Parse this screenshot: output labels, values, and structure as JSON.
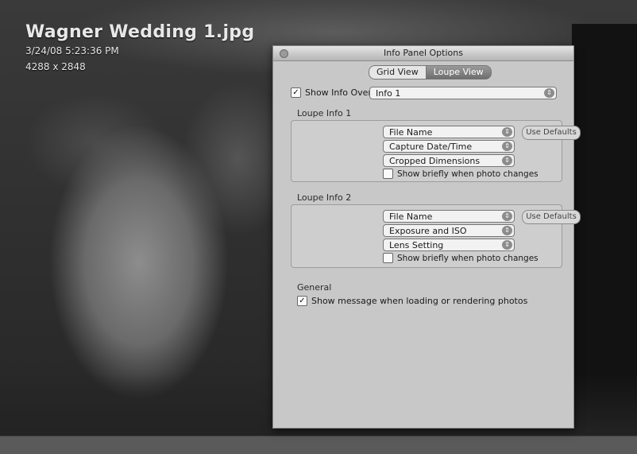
{
  "photo": {
    "filename": "Wagner Wedding 1.jpg",
    "date": "3/24/08 5:23:36 PM",
    "dimensions": "4288 x 2848"
  },
  "panel": {
    "title": "Info Panel Options",
    "tabs": [
      {
        "label": "Grid View",
        "active": false
      },
      {
        "label": "Loupe View",
        "active": true
      }
    ],
    "show_info_overlay": {
      "label": "Show Info Overlay:",
      "checked": true,
      "value": "Info 1"
    },
    "info1": {
      "label": "Loupe Info 1",
      "fields": [
        "File Name",
        "Capture Date/Time",
        "Cropped Dimensions"
      ],
      "show_briefly_label": "Show briefly when photo changes",
      "show_briefly_checked": false,
      "use_defaults_label": "Use Defaults"
    },
    "info2": {
      "label": "Loupe Info 2",
      "fields": [
        "File Name",
        "Exposure and ISO",
        "Lens Setting"
      ],
      "show_briefly_label": "Show briefly when photo changes",
      "show_briefly_checked": false,
      "use_defaults_label": "Use Defaults"
    },
    "general": {
      "label": "General",
      "show_message_label": "Show message when loading or rendering photos",
      "show_message_checked": true
    }
  },
  "icons": {
    "check": "check-icon",
    "popup_arrows": "updown-arrows-icon"
  }
}
